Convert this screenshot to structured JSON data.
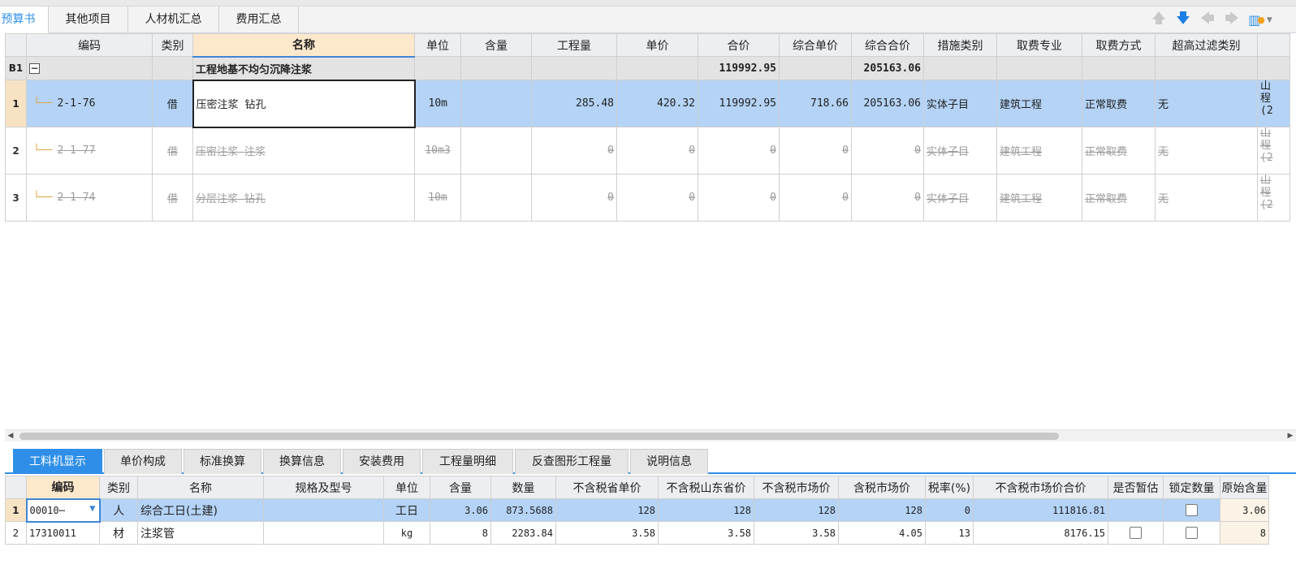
{
  "top_tabs": [
    {
      "label": "预算书",
      "display": "预算书",
      "active": true
    },
    {
      "label": "其他项目",
      "active": false
    },
    {
      "label": "人材机汇总",
      "active": false
    },
    {
      "label": "费用汇总",
      "active": false
    }
  ],
  "toolbar_icons": [
    "up-arrow-icon",
    "down-arrow-icon",
    "left-arrow-icon",
    "right-arrow-icon",
    "settings-dropdown-icon"
  ],
  "main_grid": {
    "columns": [
      "编码",
      "类别",
      "名称",
      "单位",
      "含量",
      "工程量",
      "单价",
      "合价",
      "综合单价",
      "综合合价",
      "措施类别",
      "取费专业",
      "取费方式",
      "超高过滤类别"
    ],
    "group_row": {
      "row_label": "B1",
      "collapse_symbol": "−",
      "name": "工程地基不均匀沉降注浆",
      "total_price": "119992.95",
      "composite_total": "205163.06"
    },
    "rows": [
      {
        "row": "1",
        "code": "2-1-76",
        "category": "借",
        "name": "压密注浆 钻孔",
        "unit": "10m",
        "content": "",
        "quantity": "285.48",
        "unit_price": "420.32",
        "total_price": "119992.95",
        "composite_unit_price": "718.66",
        "composite_total": "205163.06",
        "measure_category": "实体子目",
        "fee_specialty": "建筑工程",
        "fee_method": "正常取费",
        "height_filter": "无",
        "extra": "山 程 (2",
        "selected": true,
        "disabled": false
      },
      {
        "row": "2",
        "code": "2-1-77",
        "category": "借",
        "name": "压密注浆 注浆",
        "unit": "10m3",
        "content": "",
        "quantity": "0",
        "unit_price": "0",
        "total_price": "0",
        "composite_unit_price": "0",
        "composite_total": "0",
        "measure_category": "实体子目",
        "fee_specialty": "建筑工程",
        "fee_method": "正常取费",
        "height_filter": "无",
        "extra": "山 程 (2",
        "selected": false,
        "disabled": true
      },
      {
        "row": "3",
        "code": "2-1-74",
        "category": "借",
        "name": "分层注浆 钻孔",
        "unit": "10m",
        "content": "",
        "quantity": "0",
        "unit_price": "0",
        "total_price": "0",
        "composite_unit_price": "0",
        "composite_total": "0",
        "measure_category": "实体子目",
        "fee_specialty": "建筑工程",
        "fee_method": "正常取费",
        "height_filter": "无",
        "extra": "山 程 (2",
        "selected": false,
        "disabled": true
      }
    ]
  },
  "bottom_tabs": [
    {
      "label": "工料机显示",
      "active": true
    },
    {
      "label": "单价构成",
      "active": false
    },
    {
      "label": "标准换算",
      "active": false
    },
    {
      "label": "换算信息",
      "active": false
    },
    {
      "label": "安装费用",
      "active": false
    },
    {
      "label": "工程量明细",
      "active": false
    },
    {
      "label": "反查图形工程量",
      "active": false
    },
    {
      "label": "说明信息",
      "active": false
    }
  ],
  "bottom_grid": {
    "columns": [
      "编码",
      "类别",
      "名称",
      "规格及型号",
      "单位",
      "含量",
      "数量",
      "不含税省单价",
      "不含税山东省价",
      "不含税市场价",
      "含税市场价",
      "税率(%)",
      "不含税市场价合价",
      "是否暂估",
      "锁定数量",
      "原始含量"
    ],
    "rows": [
      {
        "row": "1",
        "code": "00010⋯",
        "category": "人",
        "name": "综合工日(土建)",
        "spec": "",
        "unit": "工日",
        "content": "3.06",
        "amount": "873.5688",
        "province_price": "128",
        "shandong_price": "128",
        "market_price": "128",
        "market_price_tax": "128",
        "tax_rate": "0",
        "market_total": "111816.81",
        "provisional": false,
        "lock_qty": false,
        "original_content": "3.06",
        "selected": true
      },
      {
        "row": "2",
        "code": "17310011",
        "category": "材",
        "name": "注浆管",
        "spec": "",
        "unit": "kg",
        "content": "8",
        "amount": "2283.84",
        "province_price": "3.58",
        "shandong_price": "3.58",
        "market_price": "3.58",
        "market_price_tax": "4.05",
        "tax_rate": "13",
        "market_total": "8176.15",
        "provisional": false,
        "lock_qty": false,
        "original_content": "8",
        "selected": false
      }
    ]
  },
  "colors": {
    "accent": "#2f8fe8",
    "selected_row": "#b4d3f6",
    "header_highlight": "#fde8cc",
    "group_row": "#e3e3e3"
  }
}
